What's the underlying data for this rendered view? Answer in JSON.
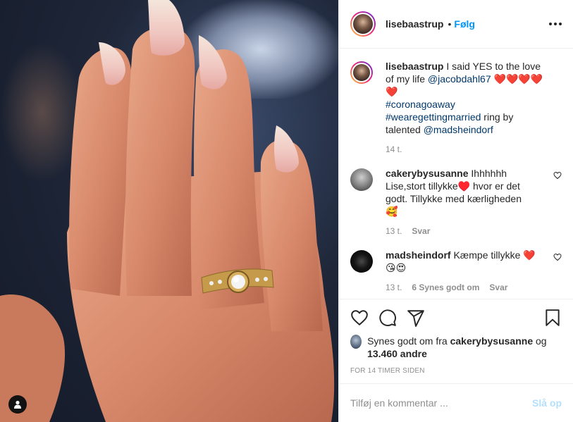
{
  "post": {
    "username": "lisebaastrup",
    "follow_label": "Følg",
    "dot": "•"
  },
  "caption": {
    "username": "lisebaastrup",
    "text_1": "I said YES to the love of my life ",
    "mention_1": "@jacobdahl67",
    "hearts": "❤️❤️❤️❤️❤️",
    "hashtag_1": "#coronagoaway",
    "hashtag_2": "#wearegettingmarried",
    "text_2": " ring by talented ",
    "mention_2": "@madsheindorf",
    "time": "14 t."
  },
  "comments": [
    {
      "username": "cakerybysusanne",
      "text": "Ihhhhhh Lise,stort tillykke♥️ hvor er det godt. Tillykke med kærligheden",
      "emoji": "🥰",
      "time": "13 t.",
      "reply_label": "Svar"
    },
    {
      "username": "madsheindorf",
      "text": "Kæmpe tillykke ",
      "heart": "❤️",
      "emoji": "😘😍",
      "time": "13 t.",
      "likes_label": "6 Synes godt om",
      "reply_label": "Svar"
    }
  ],
  "likes": {
    "prefix": "Synes godt om fra ",
    "user": "cakerybysusanne",
    "mid": " og ",
    "count": "13.460 andre"
  },
  "time_ago": "FOR 14 TIMER SIDEN",
  "add_comment": {
    "placeholder": "Tilføj en kommentar ...",
    "post_label": "Slå op"
  },
  "icons": {
    "more": "more-options-icon",
    "like": "heart-icon",
    "comment": "comment-icon",
    "share": "share-icon",
    "save": "bookmark-icon",
    "user_tag": "user-tag-icon"
  }
}
